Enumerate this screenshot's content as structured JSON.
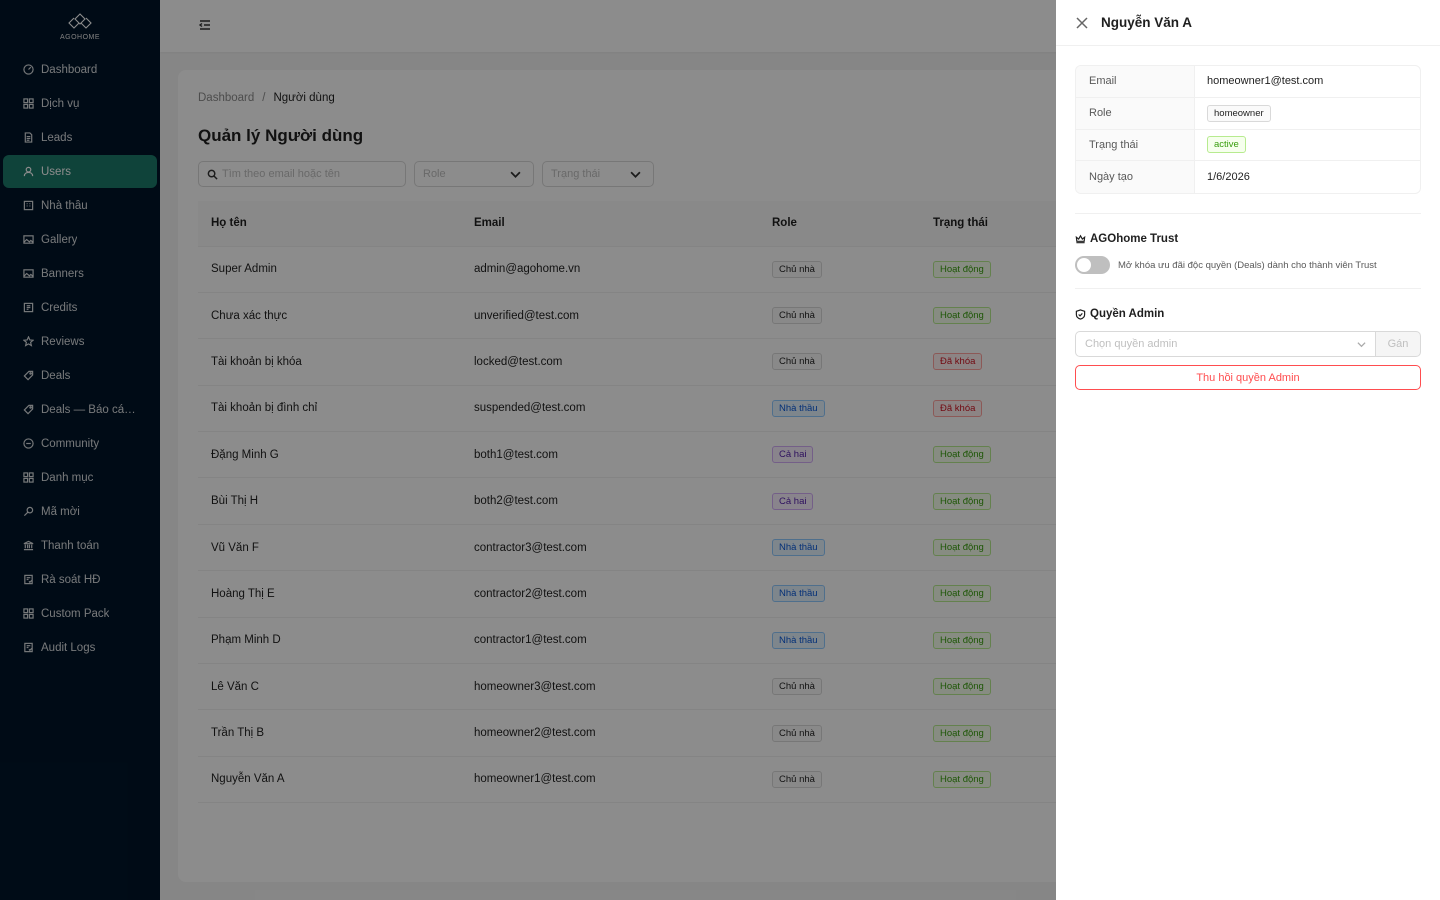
{
  "sidebar": {
    "logo_text": "AGOHOME",
    "active_color": "#1d7a6b",
    "items": [
      {
        "label": "Dashboard",
        "icon": "dashboard-icon"
      },
      {
        "label": "Dịch vụ",
        "icon": "grid-icon"
      },
      {
        "label": "Leads",
        "icon": "file-icon"
      },
      {
        "label": "Users",
        "icon": "user-icon"
      },
      {
        "label": "Nhà thầu",
        "icon": "building-icon"
      },
      {
        "label": "Gallery",
        "icon": "image-icon"
      },
      {
        "label": "Banners",
        "icon": "image-icon"
      },
      {
        "label": "Credits",
        "icon": "wallet-icon"
      },
      {
        "label": "Reviews",
        "icon": "star-icon"
      },
      {
        "label": "Deals",
        "icon": "tag-icon"
      },
      {
        "label": "Deals — Báo cáo ...",
        "icon": "tag-icon"
      },
      {
        "label": "Community",
        "icon": "message-icon"
      },
      {
        "label": "Danh mục",
        "icon": "grid-icon"
      },
      {
        "label": "Mã mời",
        "icon": "key-icon"
      },
      {
        "label": "Thanh toán",
        "icon": "bank-icon"
      },
      {
        "label": "Rà soát HĐ",
        "icon": "audit-icon"
      },
      {
        "label": "Custom Pack",
        "icon": "grid-icon"
      },
      {
        "label": "Audit Logs",
        "icon": "audit-icon"
      }
    ]
  },
  "breadcrumb": {
    "root": "Dashboard",
    "separator": "/",
    "current": "Người dùng"
  },
  "page": {
    "title": "Quản lý Người dùng"
  },
  "filters": {
    "search_placeholder": "Tìm theo email hoặc tên",
    "role_placeholder": "Role",
    "status_placeholder": "Trạng thái"
  },
  "table": {
    "columns": [
      "Họ tên",
      "Email",
      "Role",
      "Trạng thái"
    ],
    "rows": [
      {
        "name": "Super Admin",
        "email": "admin@agohome.vn",
        "role": "Chủ nhà",
        "role_color": "default",
        "status": "Hoạt động",
        "status_color": "green"
      },
      {
        "name": "Chưa xác thực",
        "email": "unverified@test.com",
        "role": "Chủ nhà",
        "role_color": "default",
        "status": "Hoạt động",
        "status_color": "green"
      },
      {
        "name": "Tài khoản bị khóa",
        "email": "locked@test.com",
        "role": "Chủ nhà",
        "role_color": "default",
        "status": "Đã khóa",
        "status_color": "red"
      },
      {
        "name": "Tài khoản bị đình chỉ",
        "email": "suspended@test.com",
        "role": "Nhà thầu",
        "role_color": "blue",
        "status": "Đã khóa",
        "status_color": "red"
      },
      {
        "name": "Đặng Minh G",
        "email": "both1@test.com",
        "role": "Cả hai",
        "role_color": "purple",
        "status": "Hoạt động",
        "status_color": "green"
      },
      {
        "name": "Bùi Thị H",
        "email": "both2@test.com",
        "role": "Cả hai",
        "role_color": "purple",
        "status": "Hoạt động",
        "status_color": "green"
      },
      {
        "name": "Vũ Văn F",
        "email": "contractor3@test.com",
        "role": "Nhà thầu",
        "role_color": "blue",
        "status": "Hoạt động",
        "status_color": "green"
      },
      {
        "name": "Hoàng Thị E",
        "email": "contractor2@test.com",
        "role": "Nhà thầu",
        "role_color": "blue",
        "status": "Hoạt động",
        "status_color": "green"
      },
      {
        "name": "Phạm Minh D",
        "email": "contractor1@test.com",
        "role": "Nhà thầu",
        "role_color": "blue",
        "status": "Hoạt động",
        "status_color": "green"
      },
      {
        "name": "Lê Văn C",
        "email": "homeowner3@test.com",
        "role": "Chủ nhà",
        "role_color": "default",
        "status": "Hoạt động",
        "status_color": "green"
      },
      {
        "name": "Trần Thị B",
        "email": "homeowner2@test.com",
        "role": "Chủ nhà",
        "role_color": "default",
        "status": "Hoạt động",
        "status_color": "green"
      },
      {
        "name": "Nguyễn Văn A",
        "email": "homeowner1@test.com",
        "role": "Chủ nhà",
        "role_color": "default",
        "status": "Hoạt động",
        "status_color": "green"
      }
    ]
  },
  "drawer": {
    "title": "Nguyễn Văn A",
    "details": [
      {
        "label": "Email",
        "value": "homeowner1@test.com",
        "type": "text"
      },
      {
        "label": "Role",
        "value": "homeowner",
        "type": "tag-default"
      },
      {
        "label": "Trạng thái",
        "value": "active",
        "type": "tag-green"
      },
      {
        "label": "Ngày tạo",
        "value": "1/6/2026",
        "type": "text"
      }
    ],
    "trust": {
      "title": "AGOhome Trust",
      "toggle_desc": "Mở khóa ưu đãi độc quyền (Deals) dành cho thành viên Trust",
      "enabled": false
    },
    "admin": {
      "title": "Quyền Admin",
      "select_placeholder": "Chọn quyền admin",
      "assign_label": "Gán",
      "revoke_label": "Thu hồi quyền Admin"
    }
  }
}
